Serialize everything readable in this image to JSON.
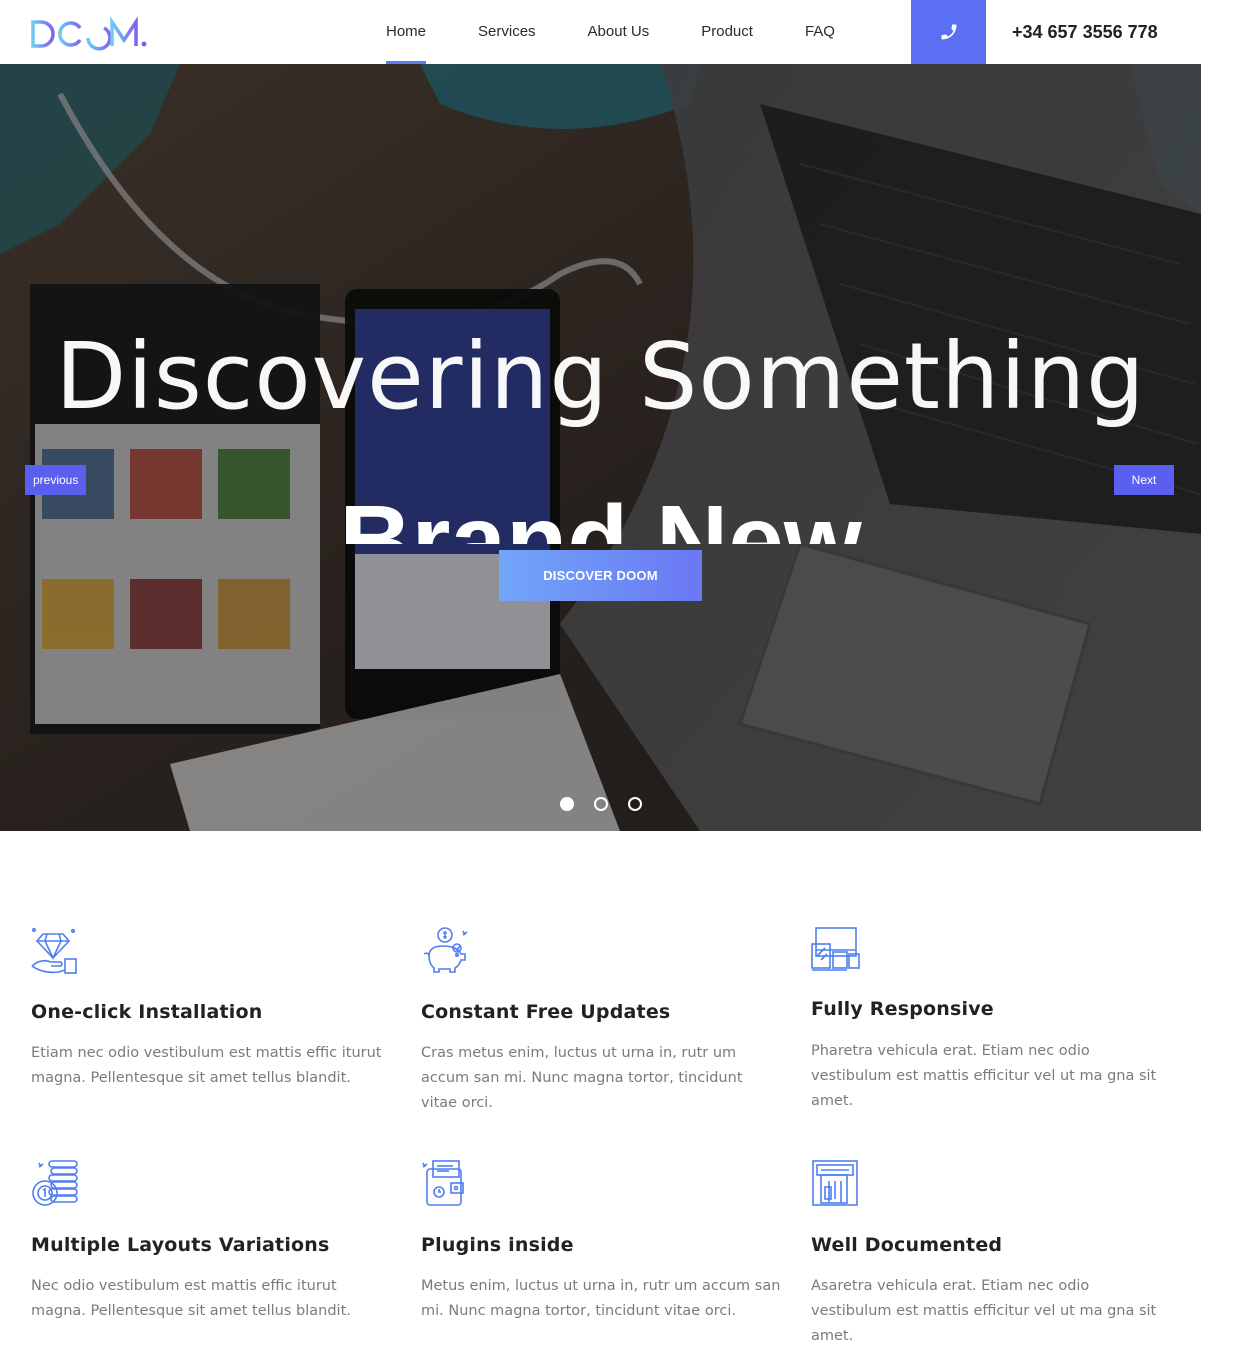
{
  "header": {
    "logo_text": "DOOM.",
    "nav": [
      {
        "label": "Home",
        "active": true
      },
      {
        "label": "Services"
      },
      {
        "label": "About Us"
      },
      {
        "label": "Product"
      },
      {
        "label": "FAQ"
      }
    ],
    "phone_icon": "phone-icon",
    "phone": "+34 657 3556 778",
    "accent_color": "#5b6ff2"
  },
  "hero": {
    "title": "Discovering Something",
    "subtitle": "Brand New",
    "prev_label": "previous",
    "next_label": "Next",
    "cta_label": "DISCOVER DOOM",
    "slides": 3,
    "active_slide": 1
  },
  "features": [
    {
      "icon": "diamond-hand-icon",
      "title": "One-click Installation",
      "text": "Etiam nec odio vestibulum est mattis effic iturut magna. Pellentesque sit amet tellus blandit."
    },
    {
      "icon": "piggy-bank-icon",
      "title": "Constant Free Updates",
      "text": "Cras metus enim, luctus ut urna in, rutr um accum san mi. Nunc magna tortor, tincidunt vitae orci."
    },
    {
      "icon": "devices-icon",
      "title": "Fully Responsive",
      "text": "Pharetra vehicula erat. Etiam nec odio vestibulum est mattis efficitur vel ut ma gna sit amet."
    },
    {
      "icon": "coins-stack-icon",
      "title": "Multiple Layouts Variations",
      "text": "Nec odio vestibulum est mattis effic iturut magna. Pellentesque sit amet tellus blandit."
    },
    {
      "icon": "wallet-calendar-icon",
      "title": "Plugins inside",
      "text": "Metus enim, luctus ut urna in, rutr um accum san mi. Nunc magna tortor, tincidunt vitae orci."
    },
    {
      "icon": "atm-card-icon",
      "title": "Well Documented",
      "text": "Asaretra vehicula erat. Etiam nec odio vestibulum est mattis efficitur vel ut ma gna sit amet."
    }
  ]
}
